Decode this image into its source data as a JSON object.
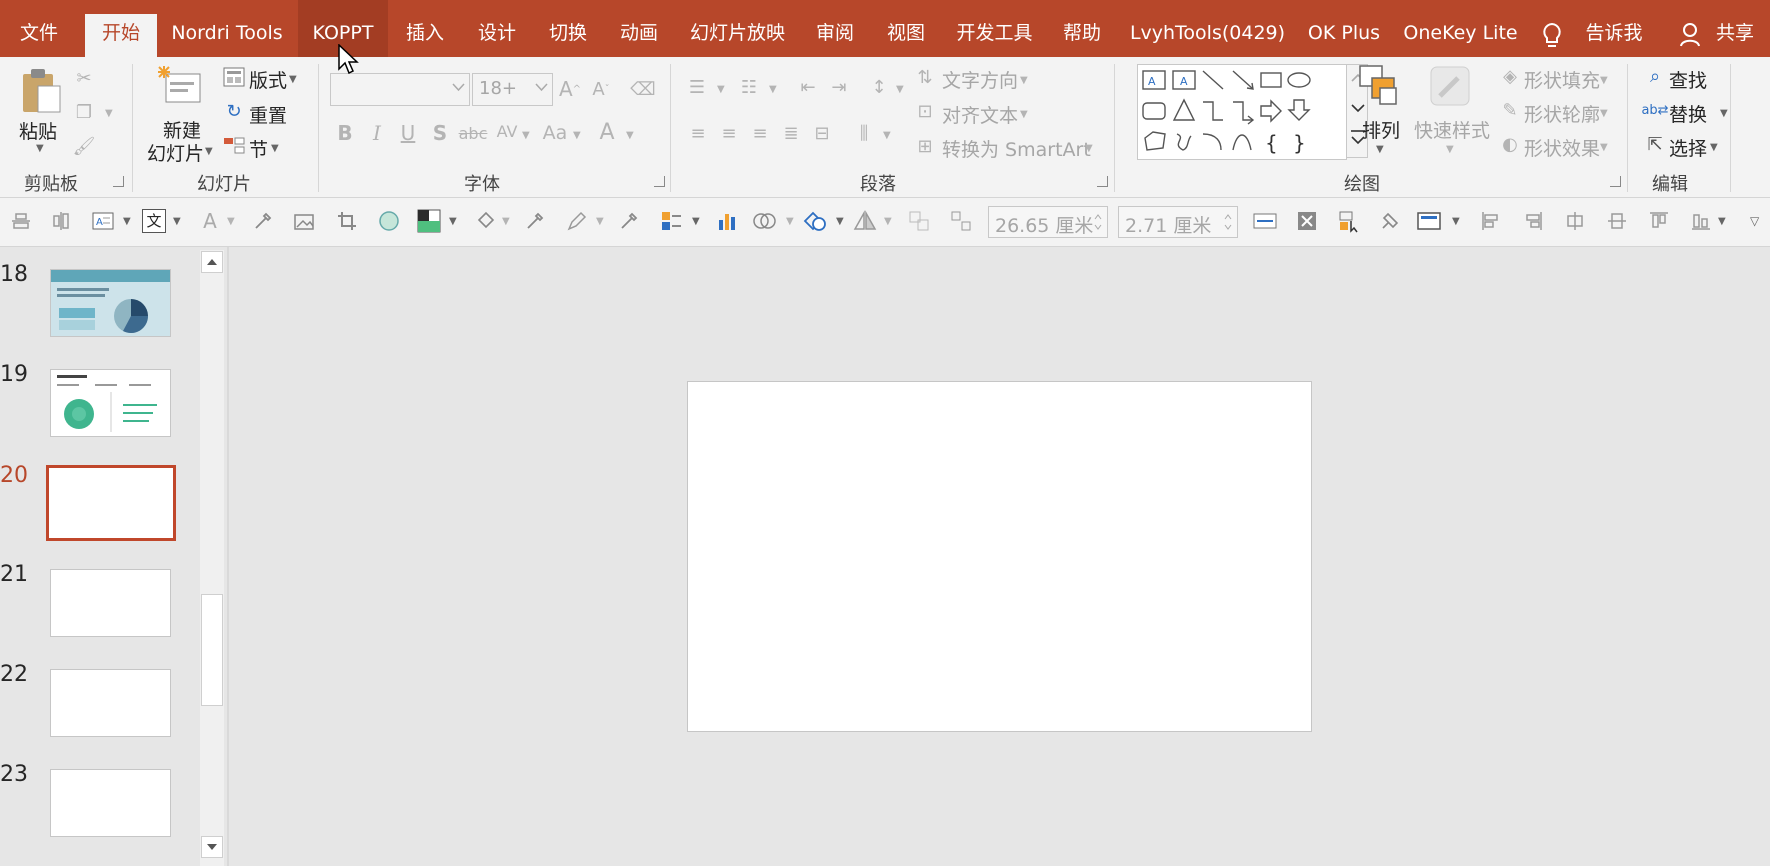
{
  "tabs": [
    {
      "label": "文件"
    },
    {
      "label": "开始"
    },
    {
      "label": "Nordri Tools"
    },
    {
      "label": "KOPPT"
    },
    {
      "label": "插入"
    },
    {
      "label": "设计"
    },
    {
      "label": "切换"
    },
    {
      "label": "动画"
    },
    {
      "label": "幻灯片放映"
    },
    {
      "label": "审阅"
    },
    {
      "label": "视图"
    },
    {
      "label": "开发工具"
    },
    {
      "label": "帮助"
    },
    {
      "label": "LvyhTools(0429)"
    },
    {
      "label": "OK Plus"
    },
    {
      "label": "OneKey Lite"
    }
  ],
  "tellme": "告诉我",
  "share": "共享",
  "colors": {
    "accent": "#b7472a",
    "ribbon": "#f3f3f3",
    "canvas": "#e6e6e6"
  },
  "groups": {
    "clipboard": {
      "label": "剪贴板",
      "paste": "粘贴"
    },
    "slides": {
      "label": "幻灯片",
      "new_slide_1": "新建",
      "new_slide_2": "幻灯片",
      "layout": "版式",
      "reset": "重置",
      "section": "节"
    },
    "font": {
      "label": "字体",
      "font_size": "18+"
    },
    "paragraph": {
      "label": "段落",
      "text_dir": "文字方向",
      "align_text": "对齐文本",
      "smartart": "转换为 SmartArt"
    },
    "drawing": {
      "label": "绘图",
      "arrange": "排列",
      "quick_styles": "快速样式",
      "fill": "形状填充",
      "outline": "形状轮廓",
      "effects": "形状效果"
    },
    "editing": {
      "label": "编辑",
      "find": "查找",
      "replace": "替换",
      "select": "选择"
    }
  },
  "quickbar": {
    "width": "26.65 厘米",
    "height": "2.71 厘米"
  },
  "slides": [
    {
      "num": "18"
    },
    {
      "num": "19"
    },
    {
      "num": "20"
    },
    {
      "num": "21"
    },
    {
      "num": "22"
    },
    {
      "num": "23"
    }
  ],
  "current_slide": "20"
}
